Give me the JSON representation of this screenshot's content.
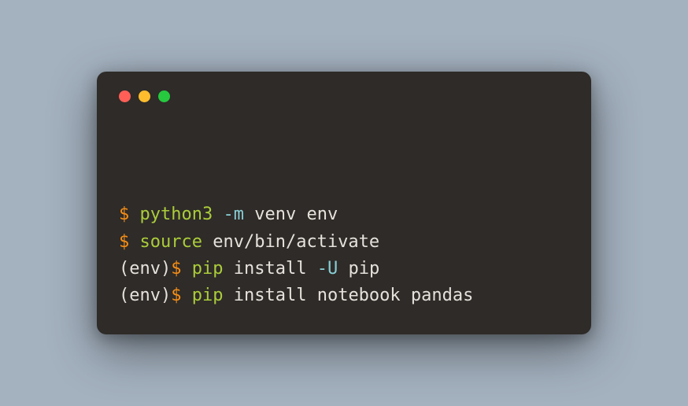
{
  "terminal": {
    "lines": [
      {
        "prefix": "",
        "prompt": "$",
        "tokens": [
          {
            "type": "cmd",
            "text": "python3"
          },
          {
            "type": "flag",
            "text": "-m"
          },
          {
            "type": "arg",
            "text": "venv"
          },
          {
            "type": "arg",
            "text": "env"
          }
        ]
      },
      {
        "prefix": "",
        "prompt": "$",
        "tokens": [
          {
            "type": "cmd",
            "text": "source"
          },
          {
            "type": "arg",
            "text": "env/bin/activate"
          }
        ]
      },
      {
        "prefix": "(env)",
        "prompt": "$",
        "tokens": [
          {
            "type": "cmd",
            "text": "pip"
          },
          {
            "type": "arg",
            "text": "install"
          },
          {
            "type": "flag",
            "text": "-U"
          },
          {
            "type": "arg",
            "text": "pip"
          }
        ]
      },
      {
        "prefix": "(env)",
        "prompt": "$",
        "tokens": [
          {
            "type": "cmd",
            "text": "pip"
          },
          {
            "type": "arg",
            "text": "install"
          },
          {
            "type": "arg",
            "text": "notebook"
          },
          {
            "type": "arg",
            "text": "pandas"
          }
        ]
      }
    ]
  }
}
